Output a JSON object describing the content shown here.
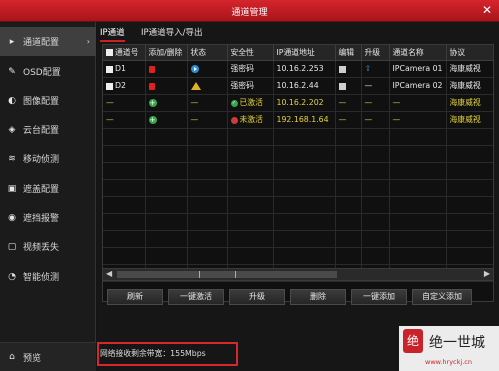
{
  "window": {
    "title": "通道管理",
    "close": "✕"
  },
  "sidebar": {
    "items": [
      {
        "label": "通道配置",
        "icon": "camera-icon",
        "glyph": "▸",
        "active": true
      },
      {
        "label": "OSD配置",
        "icon": "pen-icon",
        "glyph": "✎"
      },
      {
        "label": "图像配置",
        "icon": "image-icon",
        "glyph": "◐"
      },
      {
        "label": "云台配置",
        "icon": "ptz-icon",
        "glyph": "◈"
      },
      {
        "label": "移动侦测",
        "icon": "motion-icon",
        "glyph": "≋"
      },
      {
        "label": "遮盖配置",
        "icon": "mask-icon",
        "glyph": "▣"
      },
      {
        "label": "遮挡报警",
        "icon": "alarm-icon",
        "glyph": "◉"
      },
      {
        "label": "视频丢失",
        "icon": "video-loss-icon",
        "glyph": "▢"
      },
      {
        "label": "智能侦测",
        "icon": "smart-icon",
        "glyph": "◔"
      }
    ],
    "active_arrow": "›",
    "bottom": {
      "label": "预览",
      "icon": "home-icon",
      "glyph": "⌂"
    }
  },
  "tabs": [
    {
      "label": "IP通道",
      "active": true
    },
    {
      "label": "IP通道导入/导出",
      "active": false
    }
  ],
  "table": {
    "headers": [
      "通道号",
      "添加/删除",
      "状态",
      "安全性",
      "IP通道地址",
      "编辑",
      "升级",
      "通道名称",
      "协议"
    ],
    "rows": [
      {
        "channel": "D1",
        "status": "play",
        "security": "强密码",
        "ip": "10.16.2.253",
        "upgrade": "⇧",
        "name": "IPCamera 01",
        "protocol": "海康威视",
        "type": "device"
      },
      {
        "channel": "D2",
        "status": "warn",
        "security": "强密码",
        "ip": "10.16.2.44",
        "upgrade": "—",
        "name": "IPCamera 02",
        "protocol": "海康威视",
        "type": "device"
      },
      {
        "channel": "—",
        "status": "—",
        "security": "已激活",
        "ip": "10.16.2.202",
        "upgrade": "—",
        "name": "—",
        "protocol": "海康威视",
        "type": "active"
      },
      {
        "channel": "—",
        "status": "—",
        "security": "未激活",
        "ip": "192.168.1.64",
        "upgrade": "—",
        "name": "—",
        "protocol": "海康威视",
        "type": "inactive"
      }
    ]
  },
  "scroll": {
    "left": "◀",
    "right": "▶"
  },
  "buttons": {
    "refresh": "刷新",
    "activate": "一键激活",
    "upgrade": "升级",
    "delete": "删除",
    "add_one": "一键添加",
    "custom_add": "自定义添加"
  },
  "status": {
    "text": "网络接收剩余带宽：155Mbps"
  },
  "watermark": {
    "logo": "绝",
    "name": "绝一世城",
    "url": "www.hryckj.cn"
  }
}
